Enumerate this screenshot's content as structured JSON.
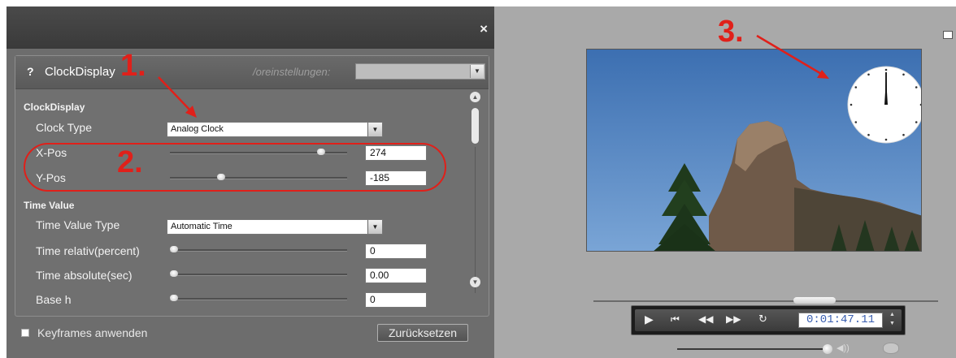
{
  "dialog": {
    "close_label": "×",
    "panel": {
      "help_label": "?",
      "title": "ClockDisplay",
      "presets_label": "/oreinstellungen:",
      "presets_value": "",
      "section_clock": "ClockDisplay",
      "clock_type_label": "Clock Type",
      "clock_type_value": "Analog Clock",
      "xpos_label": "X-Pos",
      "xpos_value": "274",
      "xpos_slider_fraction": 0.87,
      "ypos_label": "Y-Pos",
      "ypos_value": "-185",
      "ypos_slider_fraction": 0.28,
      "section_time": "Time Value",
      "time_value_type_label": "Time Value Type",
      "time_value_type_value": "Automatic Time",
      "time_relative_label": "Time relativ(percent)",
      "time_relative_value": "0",
      "time_absolute_label": "Time absolute(sec)",
      "time_absolute_value": "0.00",
      "base_h_label": "Base h",
      "base_h_value": "0"
    },
    "keyframes_label": "Keyframes anwenden",
    "reset_label": "Zurücksetzen"
  },
  "annotations": [
    "1.",
    "2.",
    "3."
  ],
  "player": {
    "timecode": "0:01:47.11",
    "seek_fraction": 0.6,
    "volume_fraction": 0.95
  },
  "colors": {
    "annotation_red": "#e0201a",
    "dialog_bg": "#6d6d6d",
    "right_bg": "#a9a9a9",
    "timecode_text": "#3a5fb0"
  },
  "icons": [
    "close-icon",
    "help-icon",
    "dropdown-arrow-icon",
    "scroll-up-icon",
    "scroll-down-icon",
    "play-icon",
    "skip-start-icon",
    "rewind-icon",
    "forward-icon",
    "loop-icon",
    "spin-up-icon",
    "spin-down-icon",
    "speaker-icon",
    "disc-icon",
    "window-restore-icon"
  ]
}
